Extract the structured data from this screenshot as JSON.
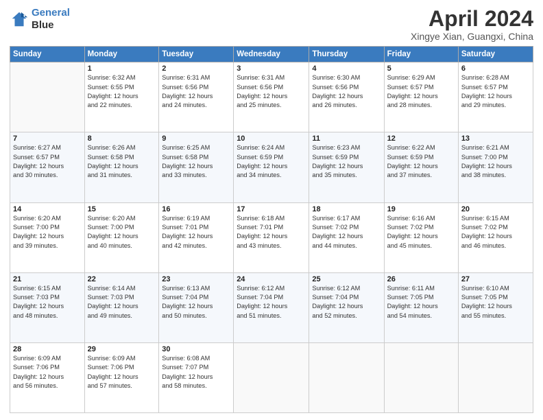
{
  "logo": {
    "line1": "General",
    "line2": "Blue"
  },
  "title": "April 2024",
  "location": "Xingye Xian, Guangxi, China",
  "days_header": [
    "Sunday",
    "Monday",
    "Tuesday",
    "Wednesday",
    "Thursday",
    "Friday",
    "Saturday"
  ],
  "weeks": [
    [
      {
        "num": "",
        "data": ""
      },
      {
        "num": "1",
        "data": "Sunrise: 6:32 AM\nSunset: 6:55 PM\nDaylight: 12 hours\nand 22 minutes."
      },
      {
        "num": "2",
        "data": "Sunrise: 6:31 AM\nSunset: 6:56 PM\nDaylight: 12 hours\nand 24 minutes."
      },
      {
        "num": "3",
        "data": "Sunrise: 6:31 AM\nSunset: 6:56 PM\nDaylight: 12 hours\nand 25 minutes."
      },
      {
        "num": "4",
        "data": "Sunrise: 6:30 AM\nSunset: 6:56 PM\nDaylight: 12 hours\nand 26 minutes."
      },
      {
        "num": "5",
        "data": "Sunrise: 6:29 AM\nSunset: 6:57 PM\nDaylight: 12 hours\nand 28 minutes."
      },
      {
        "num": "6",
        "data": "Sunrise: 6:28 AM\nSunset: 6:57 PM\nDaylight: 12 hours\nand 29 minutes."
      }
    ],
    [
      {
        "num": "7",
        "data": "Sunrise: 6:27 AM\nSunset: 6:57 PM\nDaylight: 12 hours\nand 30 minutes."
      },
      {
        "num": "8",
        "data": "Sunrise: 6:26 AM\nSunset: 6:58 PM\nDaylight: 12 hours\nand 31 minutes."
      },
      {
        "num": "9",
        "data": "Sunrise: 6:25 AM\nSunset: 6:58 PM\nDaylight: 12 hours\nand 33 minutes."
      },
      {
        "num": "10",
        "data": "Sunrise: 6:24 AM\nSunset: 6:59 PM\nDaylight: 12 hours\nand 34 minutes."
      },
      {
        "num": "11",
        "data": "Sunrise: 6:23 AM\nSunset: 6:59 PM\nDaylight: 12 hours\nand 35 minutes."
      },
      {
        "num": "12",
        "data": "Sunrise: 6:22 AM\nSunset: 6:59 PM\nDaylight: 12 hours\nand 37 minutes."
      },
      {
        "num": "13",
        "data": "Sunrise: 6:21 AM\nSunset: 7:00 PM\nDaylight: 12 hours\nand 38 minutes."
      }
    ],
    [
      {
        "num": "14",
        "data": "Sunrise: 6:20 AM\nSunset: 7:00 PM\nDaylight: 12 hours\nand 39 minutes."
      },
      {
        "num": "15",
        "data": "Sunrise: 6:20 AM\nSunset: 7:00 PM\nDaylight: 12 hours\nand 40 minutes."
      },
      {
        "num": "16",
        "data": "Sunrise: 6:19 AM\nSunset: 7:01 PM\nDaylight: 12 hours\nand 42 minutes."
      },
      {
        "num": "17",
        "data": "Sunrise: 6:18 AM\nSunset: 7:01 PM\nDaylight: 12 hours\nand 43 minutes."
      },
      {
        "num": "18",
        "data": "Sunrise: 6:17 AM\nSunset: 7:02 PM\nDaylight: 12 hours\nand 44 minutes."
      },
      {
        "num": "19",
        "data": "Sunrise: 6:16 AM\nSunset: 7:02 PM\nDaylight: 12 hours\nand 45 minutes."
      },
      {
        "num": "20",
        "data": "Sunrise: 6:15 AM\nSunset: 7:02 PM\nDaylight: 12 hours\nand 46 minutes."
      }
    ],
    [
      {
        "num": "21",
        "data": "Sunrise: 6:15 AM\nSunset: 7:03 PM\nDaylight: 12 hours\nand 48 minutes."
      },
      {
        "num": "22",
        "data": "Sunrise: 6:14 AM\nSunset: 7:03 PM\nDaylight: 12 hours\nand 49 minutes."
      },
      {
        "num": "23",
        "data": "Sunrise: 6:13 AM\nSunset: 7:04 PM\nDaylight: 12 hours\nand 50 minutes."
      },
      {
        "num": "24",
        "data": "Sunrise: 6:12 AM\nSunset: 7:04 PM\nDaylight: 12 hours\nand 51 minutes."
      },
      {
        "num": "25",
        "data": "Sunrise: 6:12 AM\nSunset: 7:04 PM\nDaylight: 12 hours\nand 52 minutes."
      },
      {
        "num": "26",
        "data": "Sunrise: 6:11 AM\nSunset: 7:05 PM\nDaylight: 12 hours\nand 54 minutes."
      },
      {
        "num": "27",
        "data": "Sunrise: 6:10 AM\nSunset: 7:05 PM\nDaylight: 12 hours\nand 55 minutes."
      }
    ],
    [
      {
        "num": "28",
        "data": "Sunrise: 6:09 AM\nSunset: 7:06 PM\nDaylight: 12 hours\nand 56 minutes."
      },
      {
        "num": "29",
        "data": "Sunrise: 6:09 AM\nSunset: 7:06 PM\nDaylight: 12 hours\nand 57 minutes."
      },
      {
        "num": "30",
        "data": "Sunrise: 6:08 AM\nSunset: 7:07 PM\nDaylight: 12 hours\nand 58 minutes."
      },
      {
        "num": "",
        "data": ""
      },
      {
        "num": "",
        "data": ""
      },
      {
        "num": "",
        "data": ""
      },
      {
        "num": "",
        "data": ""
      }
    ]
  ]
}
